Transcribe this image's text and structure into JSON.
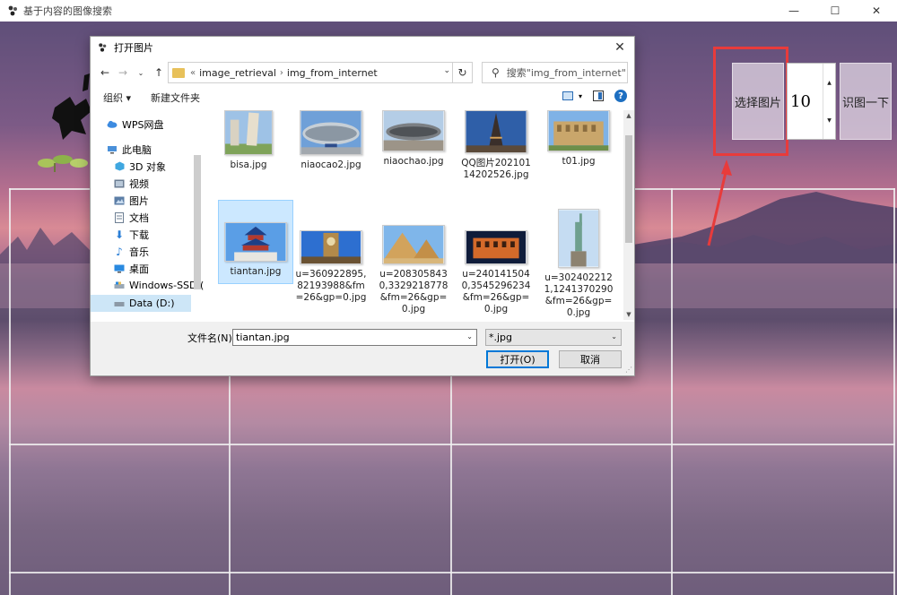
{
  "main_window": {
    "title": "基于内容的图像搜索",
    "controls": {
      "minimize": "—",
      "maximize": "☐",
      "close": "✕"
    },
    "select_button_label": "选择图片",
    "spin_value": "10",
    "recognize_button_label": "识图一下",
    "accent_color": "#e83b3b"
  },
  "dialog": {
    "title": "打开图片",
    "close": "✕",
    "address": {
      "prefix": "«",
      "segments": [
        "image_retrieval",
        "img_from_internet"
      ]
    },
    "search_placeholder": "搜索\"img_from_internet\"",
    "toolbar": {
      "organize": "组织 ▾",
      "new_folder": "新建文件夹"
    },
    "nav_tree": [
      {
        "label": "WPS网盘",
        "icon": "cloud-icon"
      },
      {
        "label": "此电脑",
        "icon": "computer-icon"
      },
      {
        "label": "3D 对象",
        "icon": "cube-icon"
      },
      {
        "label": "视频",
        "icon": "video-icon"
      },
      {
        "label": "图片",
        "icon": "pictures-icon"
      },
      {
        "label": "文档",
        "icon": "document-icon"
      },
      {
        "label": "下载",
        "icon": "download-icon"
      },
      {
        "label": "音乐",
        "icon": "music-icon"
      },
      {
        "label": "桌面",
        "icon": "desktop-icon"
      },
      {
        "label": "Windows-SSD (",
        "icon": "drive-icon"
      },
      {
        "label": "Data (D:)",
        "icon": "drive-icon",
        "selected": true
      }
    ],
    "files": [
      {
        "name": "bisa.jpg",
        "thumb": "tower"
      },
      {
        "name": "niaocao2.jpg",
        "thumb": "stadium-blue"
      },
      {
        "name": "niaochao.jpg",
        "thumb": "stadium"
      },
      {
        "name": "QQ图片20210114202526.jpg",
        "thumb": "eiffel"
      },
      {
        "name": "t01.jpg",
        "thumb": "colosseum"
      },
      {
        "name": "tiantan.jpg",
        "thumb": "temple",
        "selected": true
      },
      {
        "name": "u=360922895,82193988&fm=26&gp=0.jpg",
        "thumb": "bigben"
      },
      {
        "name": "u=2083058430,3329218778&fm=26&gp=0.jpg",
        "thumb": "pyramid"
      },
      {
        "name": "u=2401415040,3545296234&fm=26&gp=0.jpg",
        "thumb": "colosseum-night"
      },
      {
        "name": "u=3024022121,1241370290&fm=26&gp=0.jpg",
        "thumb": "liberty"
      }
    ],
    "filename_label": "文件名(N):",
    "filename_value": "tiantan.jpg",
    "filter_value": "*.jpg",
    "open_label": "打开(O)",
    "cancel_label": "取消"
  }
}
